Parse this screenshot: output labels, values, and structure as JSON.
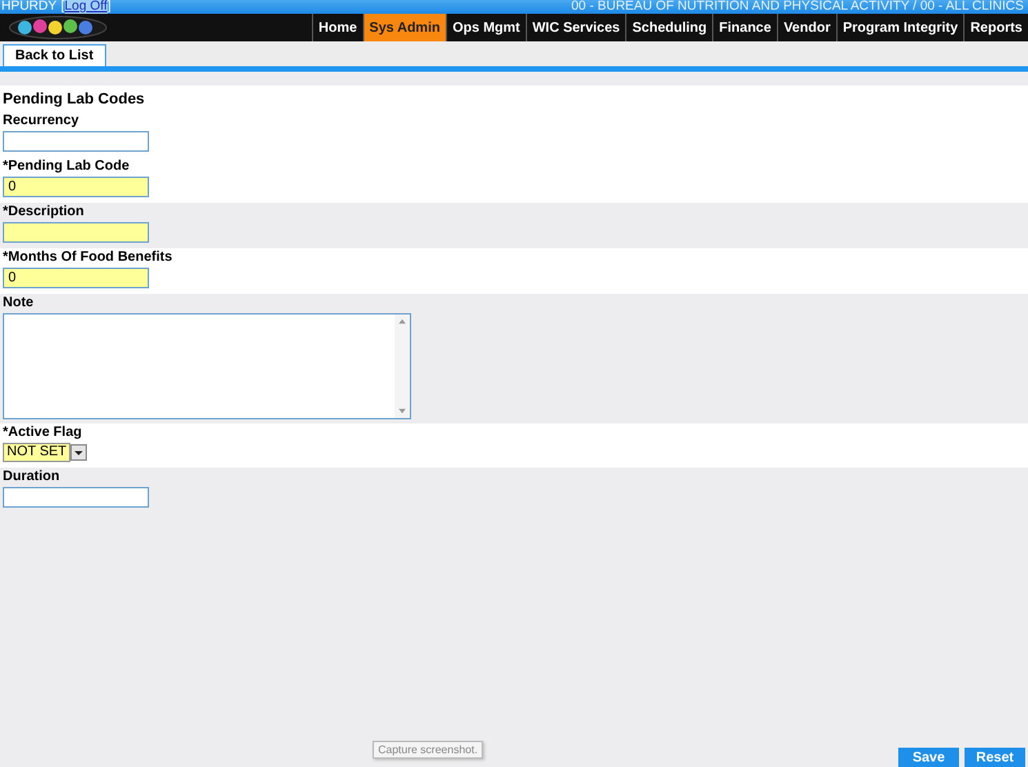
{
  "user_bar": {
    "user": "HPURDY",
    "open_bracket": "[",
    "log_off": "Log Off",
    "close_bracket": "]",
    "org": "00 - BUREAU OF NUTRITION AND PHYSICAL ACTIVITY / 00 - ALL CLINICS"
  },
  "nav": [
    {
      "label": "Home",
      "selected": false
    },
    {
      "label": "Sys Admin",
      "selected": true
    },
    {
      "label": "Ops Mgmt",
      "selected": false
    },
    {
      "label": "WIC Services",
      "selected": false
    },
    {
      "label": "Scheduling",
      "selected": false
    },
    {
      "label": "Finance",
      "selected": false
    },
    {
      "label": "Vendor",
      "selected": false
    },
    {
      "label": "Program Integrity",
      "selected": false
    },
    {
      "label": "Reports",
      "selected": false
    }
  ],
  "toolbar": {
    "back": "Back to List"
  },
  "form": {
    "title": "Pending Lab Codes",
    "fields": [
      {
        "kind": "text",
        "label": "Recurrency",
        "required": false,
        "shaded": false
      },
      {
        "kind": "text",
        "label": "*Pending Lab Code",
        "value": "0",
        "required": true,
        "shaded": false
      },
      {
        "kind": "text",
        "label": "*Description",
        "required": true,
        "shaded": true
      },
      {
        "kind": "text",
        "label": "*Months Of Food Benefits",
        "value": "0",
        "required": true,
        "shaded": false
      },
      {
        "kind": "textarea",
        "label": "Note",
        "required": false,
        "shaded": true
      },
      {
        "kind": "select",
        "label": "*Active Flag",
        "value": "NOT SET",
        "required": true,
        "shaded": false
      },
      {
        "kind": "text",
        "label": "Duration",
        "required": false,
        "shaded": true
      }
    ]
  },
  "tooltip": "Capture screenshot.",
  "buttons": [
    "Save",
    "Reset"
  ]
}
